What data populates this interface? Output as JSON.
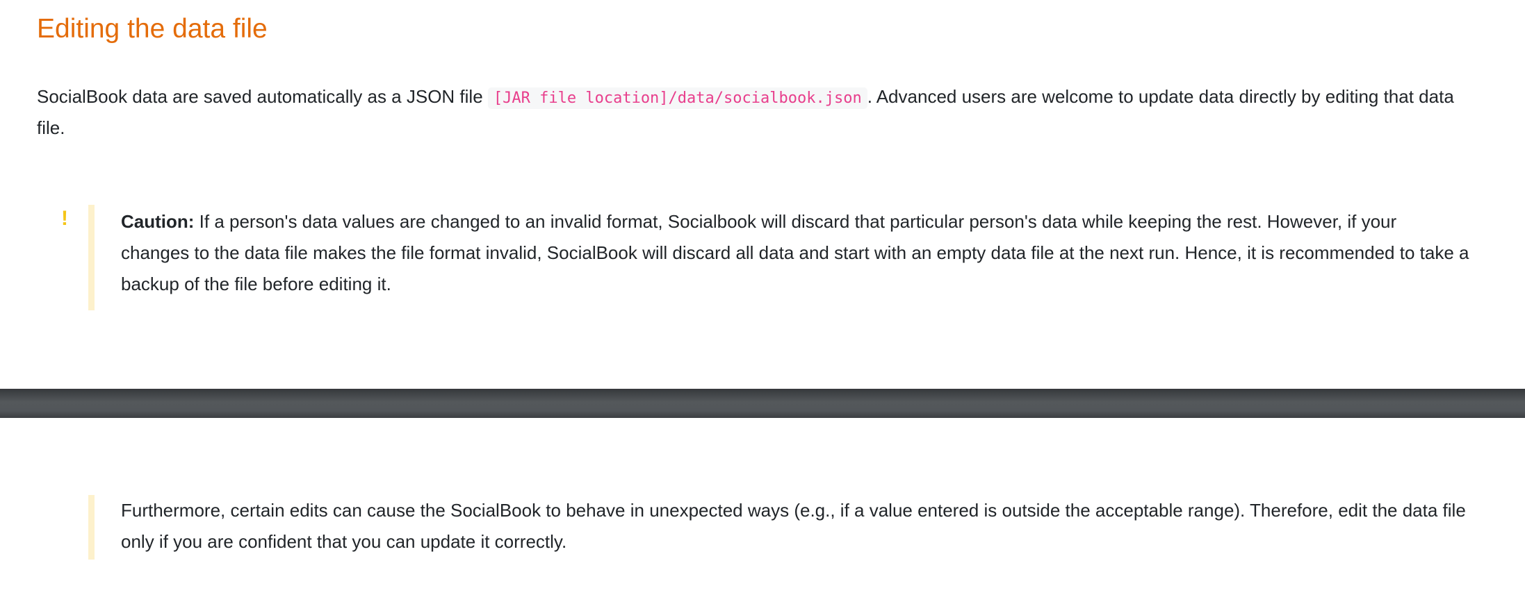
{
  "heading": "Editing the data file",
  "intro": {
    "before": "SocialBook data are saved automatically as a JSON file ",
    "code": "[JAR file location]/data/socialbook.json",
    "after": ". Advanced users are welcome to update data directly by editing that data file."
  },
  "caution": {
    "icon": "exclamation-icon",
    "icon_glyph": "!",
    "label": "Caution:",
    "text": " If a person's data values are changed to an invalid format, Socialbook will discard that particular person's data while keeping the rest. However, if your changes to the data file makes the file format invalid, SocialBook will discard all data and start with an empty data file at the next run. Hence, it is recommended to take a backup of the file before editing it."
  },
  "note2": {
    "text": "Furthermore, certain edits can cause the SocialBook to behave in unexpected ways (e.g., if a value entered is outside the acceptable range). Therefore, edit the data file only if you are confident that you can update it correctly."
  },
  "colors": {
    "heading": "#e46c0a",
    "code": "#e83e8c",
    "callout_border": "#fdf1cc",
    "icon": "#f5c518"
  }
}
